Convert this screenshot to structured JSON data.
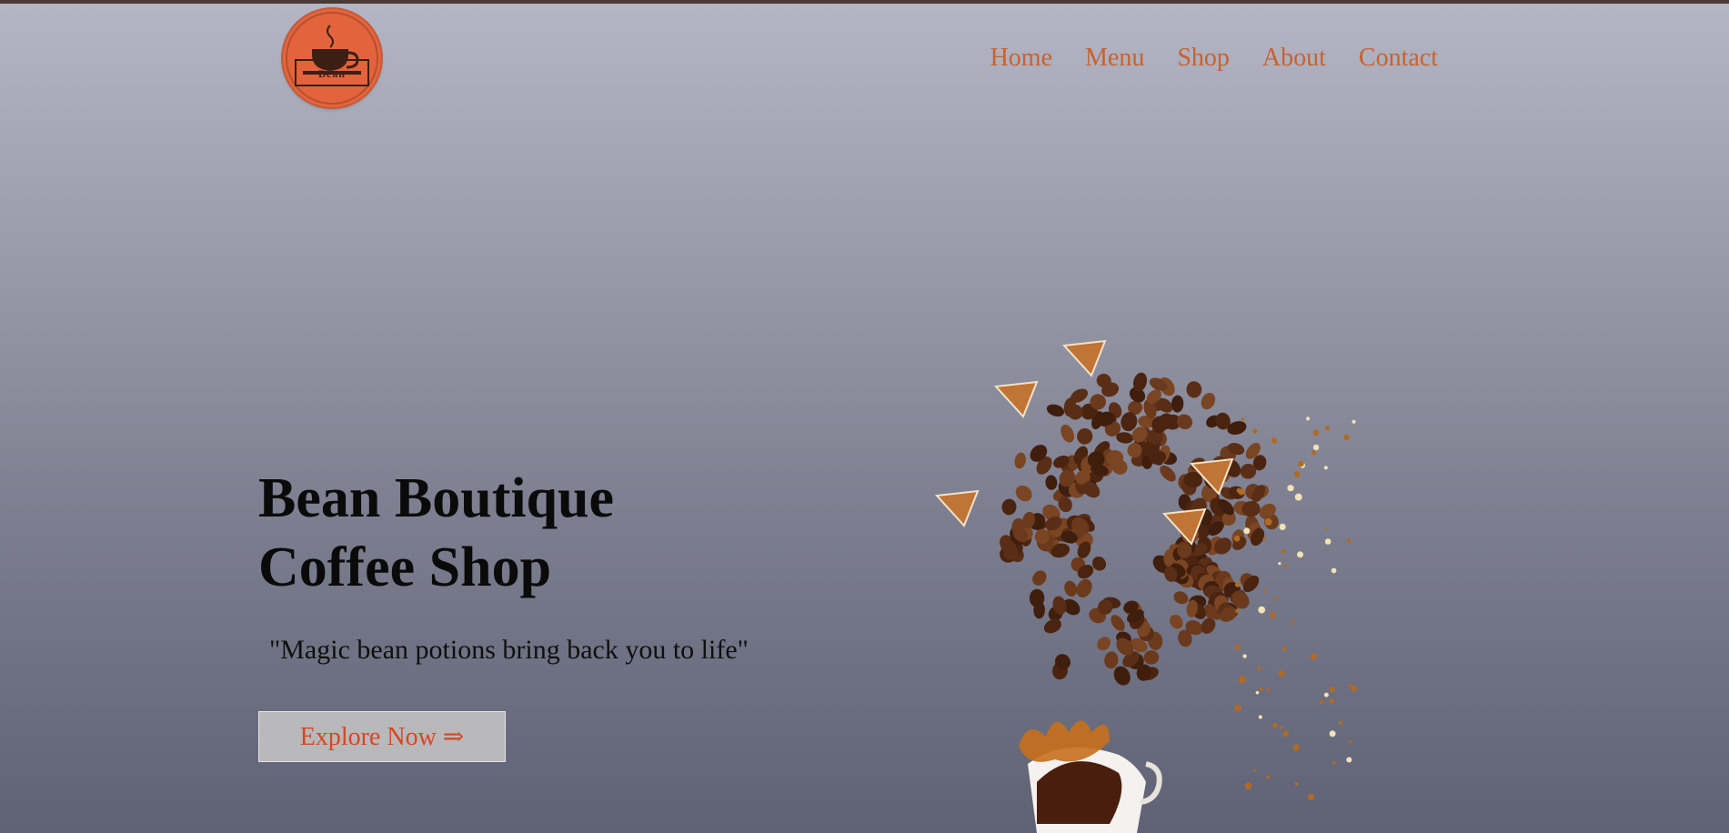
{
  "brand": {
    "logo_text": "Bean"
  },
  "nav": {
    "items": [
      "Home",
      "Menu",
      "Shop",
      "About",
      "Contact"
    ]
  },
  "hero": {
    "title_line1": "Bean Boutique",
    "title_line2": "Coffee Shop",
    "tagline": "\"Magic bean potions bring back you to life\"",
    "cta_label": "Explore Now ⇒"
  },
  "colors": {
    "nav_link": "#c9622c",
    "cta_text": "#d8461f",
    "logo_bg": "#e3643c",
    "top_border": "#4a3a36"
  },
  "icons": {
    "logo": "coffee-cup-logo",
    "hero_image": "coffee-beans-splash-illustration"
  }
}
